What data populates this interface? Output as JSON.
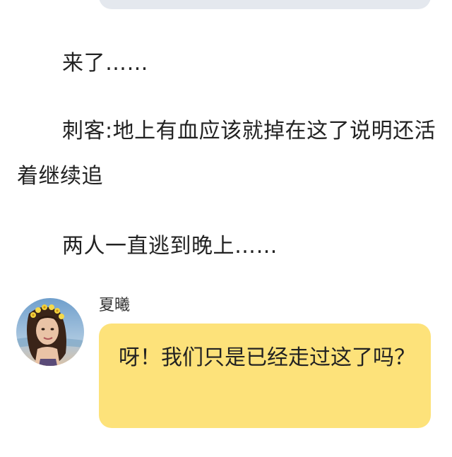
{
  "narration": [
    "来了……",
    "刺客:地上有血应该就掉在这了说明还活着继续追",
    "两人一直逃到晚上……"
  ],
  "message": {
    "speaker_name": "夏曦",
    "text": "呀！我们只是已经走过这了吗？",
    "bubble_color": "#fde27a"
  },
  "previous_bubble_color": "#e4e8ee"
}
